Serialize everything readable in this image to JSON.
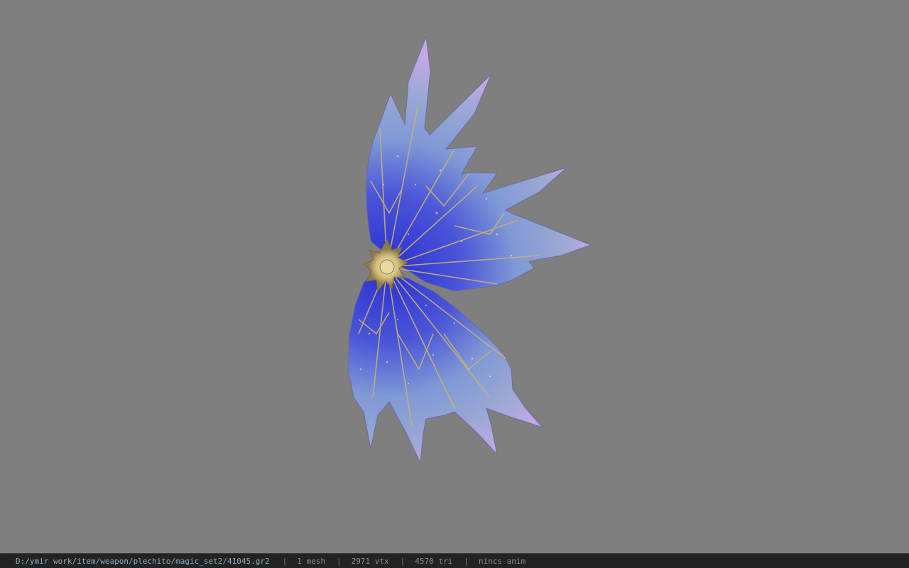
{
  "viewport": {
    "background_color": "#7f7f7f",
    "model": {
      "subject": "fan weapon model",
      "colors": {
        "blade_blue": "#3b3fd6",
        "blade_light": "#8fa6d8",
        "tip_lavender": "#b7a0dc",
        "trim_gold": "#c9b372",
        "hub_gold": "#d9c88a"
      }
    }
  },
  "status_bar": {
    "file_path": "D:/ymir work/item/weapon/plechito/magic_set2/41045.gr2",
    "separator": "|",
    "mesh_count": "1 mesh",
    "vertex_count": "2971 vtx",
    "triangle_count": "4570 tri",
    "anim_info": "nincs anim"
  }
}
